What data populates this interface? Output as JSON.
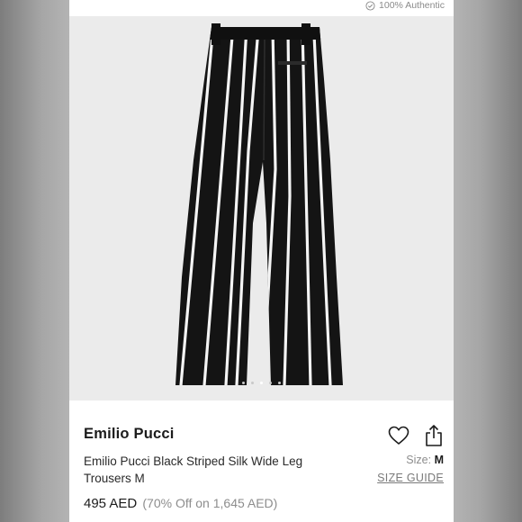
{
  "header": {
    "authentic_label": "100% Authentic",
    "authentic_icon": "check-circle-icon"
  },
  "gallery": {
    "image_count": 5,
    "active_index": 2
  },
  "product": {
    "brand": "Emilio Pucci",
    "title": "Emilio Pucci Black Striped Silk Wide Leg Trousers M",
    "price": "495 AED",
    "discount": "(70% Off on 1,645 AED)"
  },
  "size": {
    "label": "Size:",
    "value": "M",
    "guide_label": "SIZE GUIDE"
  },
  "actions": {
    "like_icon": "heart-icon",
    "share_icon": "share-icon"
  },
  "colors": {
    "text": "#1c1c1c",
    "muted": "#8d8d8d",
    "photo_bg": "#ebebeb",
    "fabric": "#141414",
    "stripe": "#f4f4f4"
  }
}
